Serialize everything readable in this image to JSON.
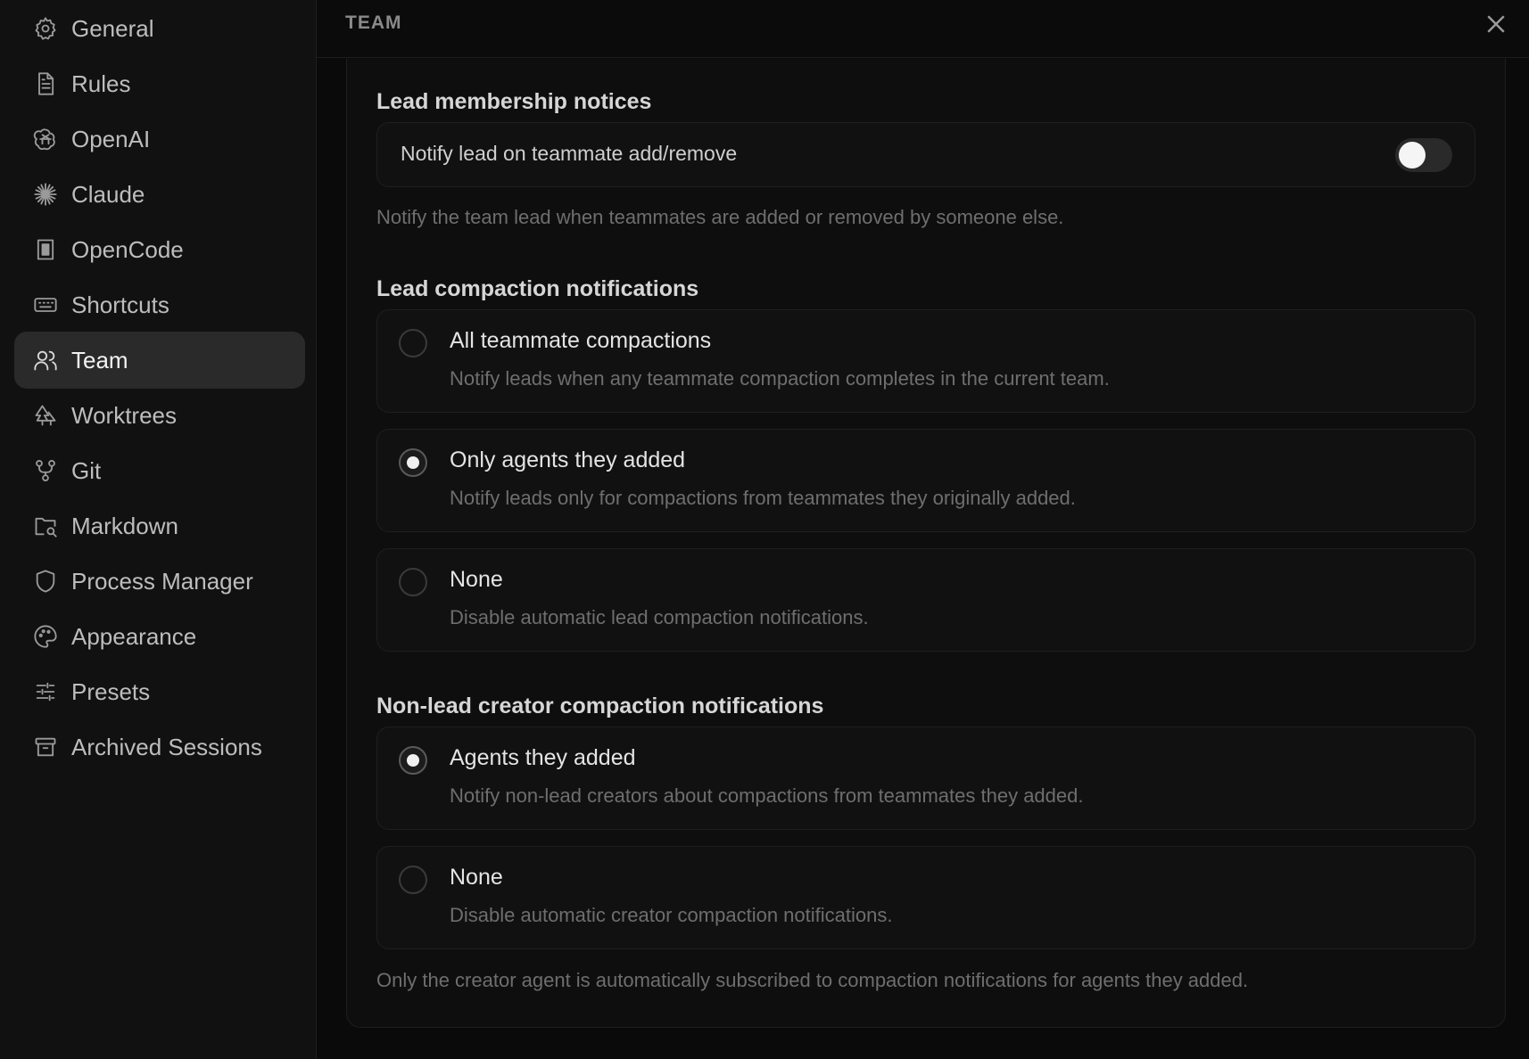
{
  "sidebar": {
    "items": [
      {
        "label": "General",
        "icon": "gear-icon"
      },
      {
        "label": "Rules",
        "icon": "document-icon"
      },
      {
        "label": "OpenAI",
        "icon": "openai-icon"
      },
      {
        "label": "Claude",
        "icon": "claude-icon"
      },
      {
        "label": "OpenCode",
        "icon": "opencode-icon"
      },
      {
        "label": "Shortcuts",
        "icon": "keyboard-icon"
      },
      {
        "label": "Team",
        "icon": "users-icon"
      },
      {
        "label": "Worktrees",
        "icon": "trees-icon"
      },
      {
        "label": "Git",
        "icon": "git-branch-icon"
      },
      {
        "label": "Markdown",
        "icon": "folder-search-icon"
      },
      {
        "label": "Process Manager",
        "icon": "shield-icon"
      },
      {
        "label": "Appearance",
        "icon": "palette-icon"
      },
      {
        "label": "Presets",
        "icon": "sliders-icon"
      },
      {
        "label": "Archived Sessions",
        "icon": "archive-icon"
      }
    ],
    "active": "Team"
  },
  "header": {
    "title": "TEAM"
  },
  "membership": {
    "title": "Lead membership notices",
    "toggle_label": "Notify lead on teammate add/remove",
    "toggle_on": false,
    "help": "Notify the team lead when teammates are added or removed by someone else."
  },
  "lead_compaction": {
    "title": "Lead compaction notifications",
    "options": [
      {
        "title": "All teammate compactions",
        "desc": "Notify leads when any teammate compaction completes in the current team.",
        "selected": false
      },
      {
        "title": "Only agents they added",
        "desc": "Notify leads only for compactions from teammates they originally added.",
        "selected": true
      },
      {
        "title": "None",
        "desc": "Disable automatic lead compaction notifications.",
        "selected": false
      }
    ]
  },
  "creator_compaction": {
    "title": "Non-lead creator compaction notifications",
    "options": [
      {
        "title": "Agents they added",
        "desc": "Notify non-lead creators about compactions from teammates they added.",
        "selected": true
      },
      {
        "title": "None",
        "desc": "Disable automatic creator compaction notifications.",
        "selected": false
      }
    ],
    "help": "Only the creator agent is automatically subscribed to compaction notifications for agents they added."
  }
}
